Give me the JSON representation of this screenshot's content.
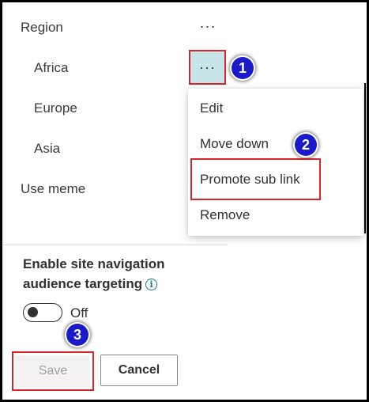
{
  "nav": {
    "items": [
      {
        "label": "Region"
      },
      {
        "label": "Africa"
      },
      {
        "label": "Europe"
      },
      {
        "label": "Asia"
      },
      {
        "label": "Use meme"
      }
    ],
    "more_glyph": "···"
  },
  "context_menu": {
    "items": [
      {
        "label": "Edit"
      },
      {
        "label": "Move down"
      },
      {
        "label": "Promote sub link"
      },
      {
        "label": "Remove"
      }
    ]
  },
  "audience_targeting": {
    "heading_line1": "Enable site navigation",
    "heading_line2": "audience targeting",
    "info_glyph": "i",
    "toggle_state": "Off"
  },
  "buttons": {
    "save": "Save",
    "cancel": "Cancel"
  },
  "step_badges": [
    "1",
    "2",
    "3"
  ],
  "colors": {
    "highlight_box": "#d9242a",
    "badge": "#1a1ac8",
    "active_more_bg": "#c7e5e8"
  }
}
